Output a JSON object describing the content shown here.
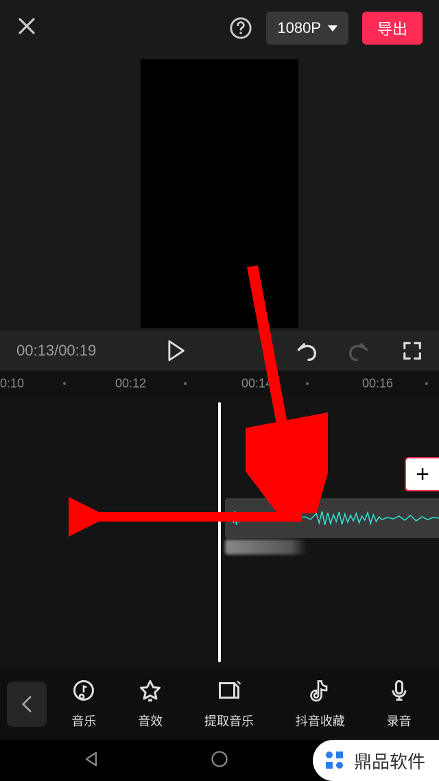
{
  "topbar": {
    "resolution": "1080P",
    "export_label": "导出"
  },
  "playbar": {
    "time_current": "00:13",
    "time_total": "00:19"
  },
  "ruler": {
    "ticks": [
      {
        "label": "0:10",
        "pos": 0
      },
      {
        "label": "00:12",
        "pos": 168
      },
      {
        "label": "00:14",
        "pos": 352
      },
      {
        "label": "00:16",
        "pos": 528
      }
    ],
    "dots": [
      92,
      268,
      446,
      620
    ]
  },
  "timeline": {
    "add_label": "+"
  },
  "menu": {
    "items": [
      {
        "label": "音乐",
        "icon": "music-icon"
      },
      {
        "label": "音效",
        "icon": "sound-effect-icon"
      },
      {
        "label": "提取音乐",
        "icon": "extract-music-icon"
      },
      {
        "label": "抖音收藏",
        "icon": "douyin-favorites-icon"
      },
      {
        "label": "录音",
        "icon": "record-icon"
      }
    ]
  },
  "watermark": {
    "text": "鼎品软件"
  }
}
